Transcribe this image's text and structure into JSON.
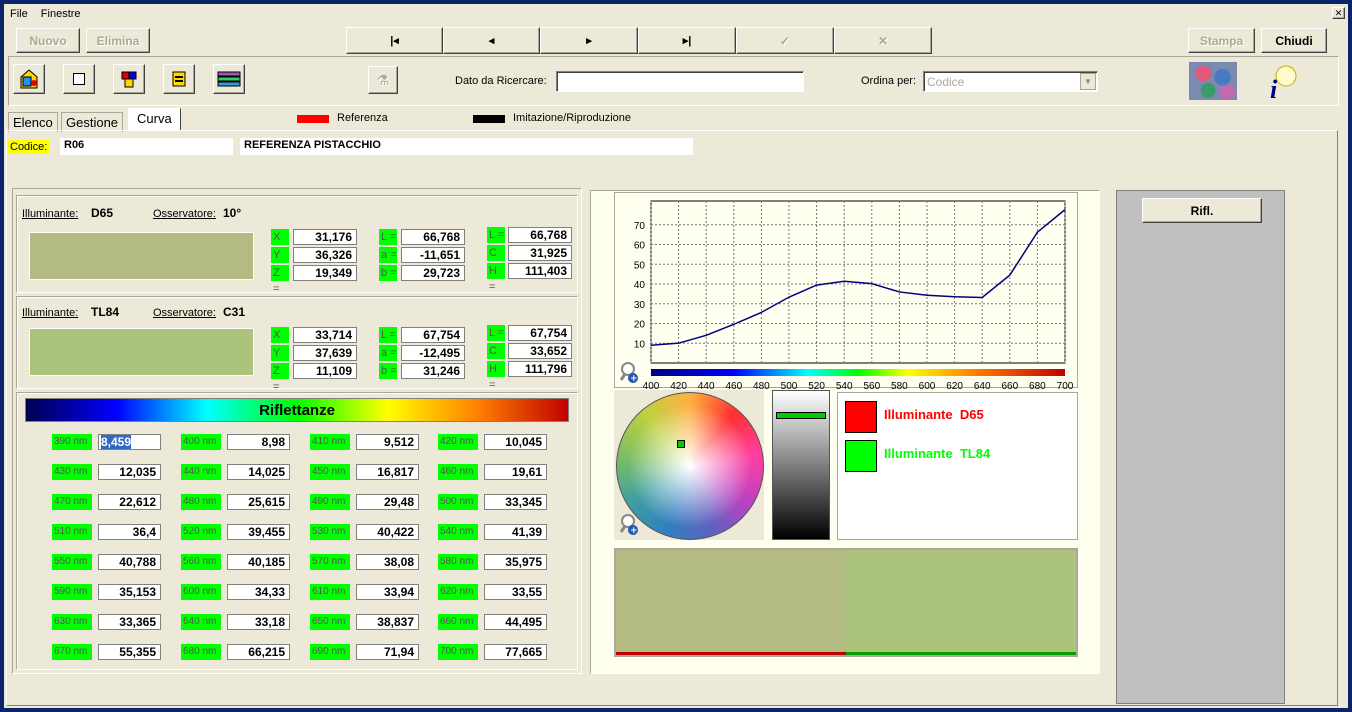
{
  "menu": [
    "File",
    "Finestre"
  ],
  "toolbar": {
    "nuovo": "Nuovo",
    "elimina": "Elimina",
    "first": "|◂",
    "prev": "◂",
    "next": "▸",
    "last": "▸|",
    "confirm": "✓",
    "cancel": "✕",
    "stampa": "Stampa",
    "chiudi": "Chiudi"
  },
  "search": {
    "label": "Dato da Ricercare:",
    "value": "",
    "order_label": "Ordina per:",
    "order_value": "Codice"
  },
  "tabs": [
    "Elenco",
    "Gestione",
    "Curva"
  ],
  "legend": {
    "ref": "Referenza",
    "imit": "Imitazione/Riproduzione"
  },
  "codice": {
    "label": "Codice:",
    "code": "R06",
    "name": "REFERENZA PISTACCHIO"
  },
  "panel1": {
    "ill_label": "Illuminante:",
    "ill": "D65",
    "obs_label": "Osservatore:",
    "obs": "10°",
    "x_lbl": "X =",
    "x": "31,176",
    "y_lbl": "Y =",
    "y": "36,326",
    "z_lbl": "Z =",
    "z": "19,349",
    "l_lbl": "L =",
    "l": "66,768",
    "a_lbl": "a =",
    "a": "-11,651",
    "b_lbl": "b =",
    "b": "29,723",
    "l2_lbl": "L =",
    "l2": "66,768",
    "c_lbl": "C =",
    "c": "31,925",
    "h_lbl": "H =",
    "h": "111,403",
    "swatch": "#b3bb83"
  },
  "panel2": {
    "ill_label": "Illuminante:",
    "ill": "TL84",
    "obs_label": "Osservatore:",
    "obs": "C31",
    "x_lbl": "X =",
    "x": "33,714",
    "y_lbl": "Y =",
    "y": "37,639",
    "z_lbl": "Z =",
    "z": "11,109",
    "l_lbl": "L =",
    "l": "67,754",
    "a_lbl": "a =",
    "a": "-12,495",
    "b_lbl": "b =",
    "b": "31,246",
    "l2_lbl": "L =",
    "l2": "67,754",
    "c_lbl": "C =",
    "c": "33,652",
    "h_lbl": "H =",
    "h": "111,796",
    "swatch": "#abc37a"
  },
  "riflettanze_title": "Riflettanze",
  "reflectances": [
    {
      "nm": "390 nm",
      "v": "8,459"
    },
    {
      "nm": "400 nm",
      "v": "8,98"
    },
    {
      "nm": "410 nm",
      "v": "9,512"
    },
    {
      "nm": "420 nm",
      "v": "10,045"
    },
    {
      "nm": "430 nm",
      "v": "12,035"
    },
    {
      "nm": "440 nm",
      "v": "14,025"
    },
    {
      "nm": "450 nm",
      "v": "16,817"
    },
    {
      "nm": "460 nm",
      "v": "19,61"
    },
    {
      "nm": "470 nm",
      "v": "22,612"
    },
    {
      "nm": "480 nm",
      "v": "25,615"
    },
    {
      "nm": "490 nm",
      "v": "29,48"
    },
    {
      "nm": "500 nm",
      "v": "33,345"
    },
    {
      "nm": "510 nm",
      "v": "36,4"
    },
    {
      "nm": "520 nm",
      "v": "39,455"
    },
    {
      "nm": "530 nm",
      "v": "40,422"
    },
    {
      "nm": "540 nm",
      "v": "41,39"
    },
    {
      "nm": "550 nm",
      "v": "40,788"
    },
    {
      "nm": "560 nm",
      "v": "40,185"
    },
    {
      "nm": "570 nm",
      "v": "38,08"
    },
    {
      "nm": "580 nm",
      "v": "35,975"
    },
    {
      "nm": "590 nm",
      "v": "35,153"
    },
    {
      "nm": "600 nm",
      "v": "34,33"
    },
    {
      "nm": "610 nm",
      "v": "33,94"
    },
    {
      "nm": "620 nm",
      "v": "33,55"
    },
    {
      "nm": "630 nm",
      "v": "33,365"
    },
    {
      "nm": "640 nm",
      "v": "33,18"
    },
    {
      "nm": "650 nm",
      "v": "38,837"
    },
    {
      "nm": "660 nm",
      "v": "44,495"
    },
    {
      "nm": "670 nm",
      "v": "55,355"
    },
    {
      "nm": "680 nm",
      "v": "66,215"
    },
    {
      "nm": "690 nm",
      "v": "71,94"
    },
    {
      "nm": "700 nm",
      "v": "77,665"
    }
  ],
  "chart_data": {
    "type": "line",
    "x": [
      400,
      420,
      440,
      460,
      480,
      500,
      520,
      540,
      560,
      580,
      600,
      620,
      640,
      660,
      680,
      700
    ],
    "series": [
      {
        "values": [
          8.98,
          10.045,
          14.025,
          19.61,
          25.615,
          33.345,
          39.455,
          41.39,
          40.185,
          35.975,
          34.33,
          33.55,
          33.18,
          44.495,
          66.215,
          77.665
        ],
        "color": "#000080"
      }
    ],
    "ylim": [
      0,
      80
    ],
    "yticks": [
      10,
      20,
      30,
      40,
      50,
      60,
      70
    ],
    "xticks": [
      400,
      420,
      440,
      460,
      480,
      500,
      520,
      540,
      560,
      580,
      600,
      620,
      640,
      660,
      680,
      700
    ],
    "grid": true
  },
  "illum_legend": [
    {
      "label": "Illuminante  D65",
      "color": "#ff0000"
    },
    {
      "label": "Illuminante  TL84",
      "color": "#00ff00"
    }
  ],
  "compare": {
    "left": "#b3bb83",
    "right": "#abc37a"
  },
  "rifl_button": "Rifl."
}
